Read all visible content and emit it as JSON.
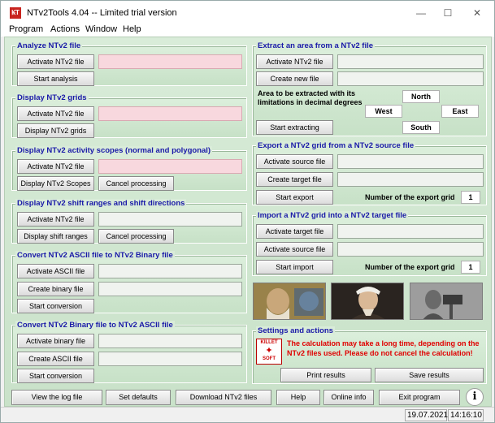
{
  "window": {
    "title": "NTv2Tools 4.04 -- Limited trial version",
    "icon": "ntv2tools-app-icon",
    "controls": {
      "minimize": "—",
      "maximize": "☐",
      "close": "✕"
    }
  },
  "menu": [
    "Program",
    "Actions",
    "Window",
    "Help"
  ],
  "colors": {
    "panel_title": "#1a1aa8",
    "warning": "#e00000",
    "pink_field": "#f8d8de",
    "panel_bg": "#d9ecd9"
  },
  "panels": {
    "analyze": {
      "title": "Analyze NTv2 file",
      "activate": "Activate NTv2 file",
      "start": "Start analysis"
    },
    "display_grids": {
      "title": "Display NTv2 grids",
      "activate": "Activate NTv2 file",
      "display": "Display NTv2 grids"
    },
    "activity": {
      "title": "Display NTv2 activity scopes (normal and polygonal)",
      "activate": "Activate NTv2 file",
      "display": "Display NTv2 Scopes",
      "cancel": "Cancel processing"
    },
    "shift": {
      "title": "Display NTv2 shift ranges and shift directions",
      "activate": "Activate NTv2 file",
      "display": "Display shift ranges",
      "cancel": "Cancel processing"
    },
    "ascii_to_bin": {
      "title": "Convert NTv2 ASCII file to NTv2 Binary file",
      "activate": "Activate ASCII file",
      "create": "Create binary file",
      "start": "Start conversion"
    },
    "bin_to_ascii": {
      "title": "Convert NTv2 Binary file to NTv2 ASCII file",
      "activate": "Activate binary file",
      "create": "Create ASCII file",
      "start": "Start conversion"
    },
    "extract": {
      "title": "Extract an area from a NTv2 file",
      "activate": "Activate NTv2 file",
      "create": "Create new file",
      "area_label": "Area to be extracted with its limitations in decimal degrees",
      "north": "North",
      "west": "West",
      "east": "East",
      "south": "South",
      "start": "Start extracting"
    },
    "export": {
      "title": "Export a NTv2 grid from a NTv2 source file",
      "activate_source": "Activate source file",
      "create_target": "Create target file",
      "start": "Start export",
      "grid_label": "Number of the export grid",
      "grid_value": "1"
    },
    "import": {
      "title": "Import a NTv2 grid into a NTv2 target file",
      "activate_target": "Activate target file",
      "activate_source": "Activate source file",
      "start": "Start import",
      "grid_label": "Number of the export grid",
      "grid_value": "1"
    },
    "settings": {
      "title": "Settings and actions",
      "logo_top": "KILLET",
      "logo_bottom": "SOFT",
      "warning": "The calculation may take a long time, depending on the NTv2 files used. Please do not cancel the calculation!",
      "print": "Print results",
      "save": "Save results"
    }
  },
  "bottom_buttons": [
    "View the log file",
    "Set defaults",
    "Download NTv2 files",
    "Help",
    "Online info",
    "Exit program"
  ],
  "info_icon": "i",
  "status": {
    "date": "19.07.2021",
    "time": "14:16:10"
  }
}
